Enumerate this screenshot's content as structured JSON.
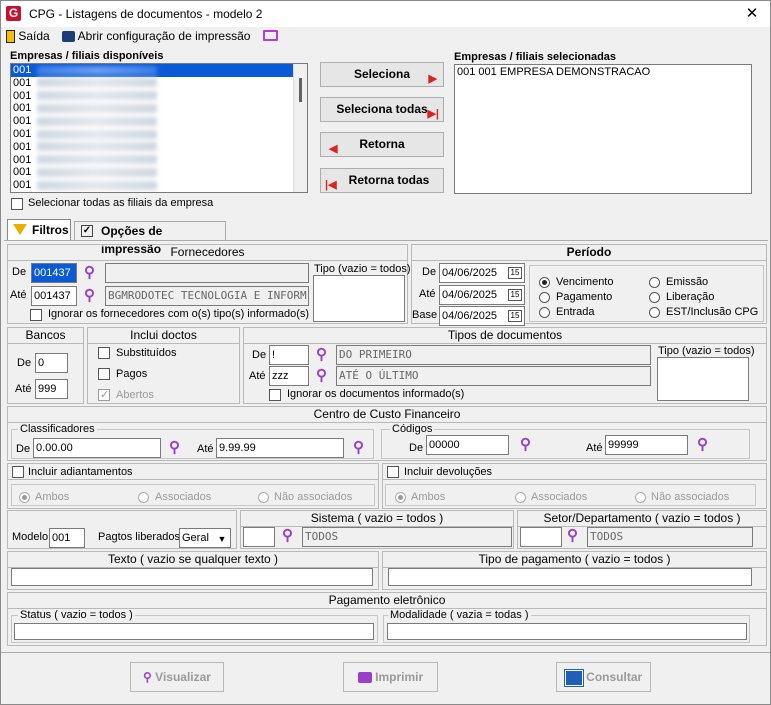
{
  "window": {
    "title": "CPG - Listagens de documentos - modelo 2",
    "close": "✕"
  },
  "toolbar": {
    "exit_label": "Saída",
    "print_config_label": "Abrir configuração de impressão"
  },
  "available": {
    "header": "Empresas / filiais disponíveis",
    "items": [
      "001",
      "001",
      "001",
      "001",
      "001",
      "001",
      "001",
      "001",
      "001",
      "001"
    ]
  },
  "selected": {
    "header": "Empresas / filiais selecionadas",
    "items": [
      "001 001 EMPRESA DEMONSTRACAO"
    ]
  },
  "buttons": {
    "select": "Seleciona",
    "select_all": "Seleciona todas",
    "return": "Retorna",
    "return_all": "Retorna todas"
  },
  "select_all_branches": "Selecionar todas as filiais da empresa",
  "tabs": {
    "filters": "Filtros",
    "print_options": "Opções de impressão"
  },
  "fornecedores": {
    "title": "Fornecedores",
    "de_label": "De",
    "ate_label": "Até",
    "de_value": "001437",
    "ate_value": "001437",
    "de_name": "",
    "ate_name": "BGMRODOTEC TECNOLOGIA E INFORM",
    "tipo_label": "Tipo (vazio = todos)",
    "ignore_label": "Ignorar os fornecedores com o(s) tipo(s) informado(s)"
  },
  "periodo": {
    "title": "Período",
    "de_label": "De",
    "ate_label": "Até",
    "base_label": "Base",
    "de_value": "04/06/2025",
    "ate_value": "04/06/2025",
    "base_value": "04/06/2025",
    "cal_label": "15",
    "radios": [
      "Vencimento",
      "Emissão",
      "Pagamento",
      "Liberação",
      "Entrada",
      "EST/Inclusão CPG"
    ]
  },
  "bancos": {
    "title": "Bancos",
    "de_label": "De",
    "ate_label": "Até",
    "de_value": "0",
    "ate_value": "999"
  },
  "inclui": {
    "title": "Inclui doctos",
    "items": [
      "Substituídos",
      "Pagos",
      "Abertos"
    ]
  },
  "tipos": {
    "title": "Tipos de documentos",
    "de_label": "De",
    "ate_label": "Até",
    "de_value": "!",
    "ate_value": "zzz",
    "de_name": "DO PRIMEIRO",
    "ate_name": "ATÉ O ÚLTIMO",
    "tipo_label": "Tipo (vazio = todos)",
    "ignore_label": "Ignorar os documentos informado(s)"
  },
  "centro": {
    "title": "Centro de Custo Financeiro",
    "class_title": "Classificadores",
    "codes_title": "Códigos",
    "de_label": "De",
    "ate_label": "Até",
    "class_de": "0.00.00",
    "class_ate": "9.99.99",
    "code_de": "00000",
    "code_ate": "99999"
  },
  "adiant": {
    "label": "Incluir adiantamentos",
    "radios": [
      "Ambos",
      "Associados",
      "Não associados"
    ]
  },
  "devol": {
    "label": "Incluir devoluções",
    "radios": [
      "Ambos",
      "Associados",
      "Não associados"
    ]
  },
  "modelo": {
    "label": "Modelo",
    "value": "001",
    "pagtos_label": "Pagtos liberados",
    "pagtos_value": "Geral"
  },
  "sistema": {
    "title": "Sistema ( vazio = todos )",
    "value": "",
    "name": "TODOS"
  },
  "setor": {
    "title": "Setor/Departamento ( vazio = todos )",
    "value": "",
    "name": "TODOS"
  },
  "texto": {
    "title": "Texto ( vazio se qualquer texto )",
    "value": ""
  },
  "tipopag": {
    "title": "Tipo de pagamento ( vazio = todos )",
    "value": ""
  },
  "pagel": {
    "title": "Pagamento eletrônico",
    "status_title": "Status ( vazio = todos )",
    "mod_title": "Modalidade ( vazia = todas )"
  },
  "footer": {
    "view": "Visualizar",
    "print": "Imprimir",
    "consult": "Consultar"
  },
  "colors": {
    "accent": "#0a5ad8",
    "icon": "#9a3fc7",
    "danger": "#d22222"
  }
}
